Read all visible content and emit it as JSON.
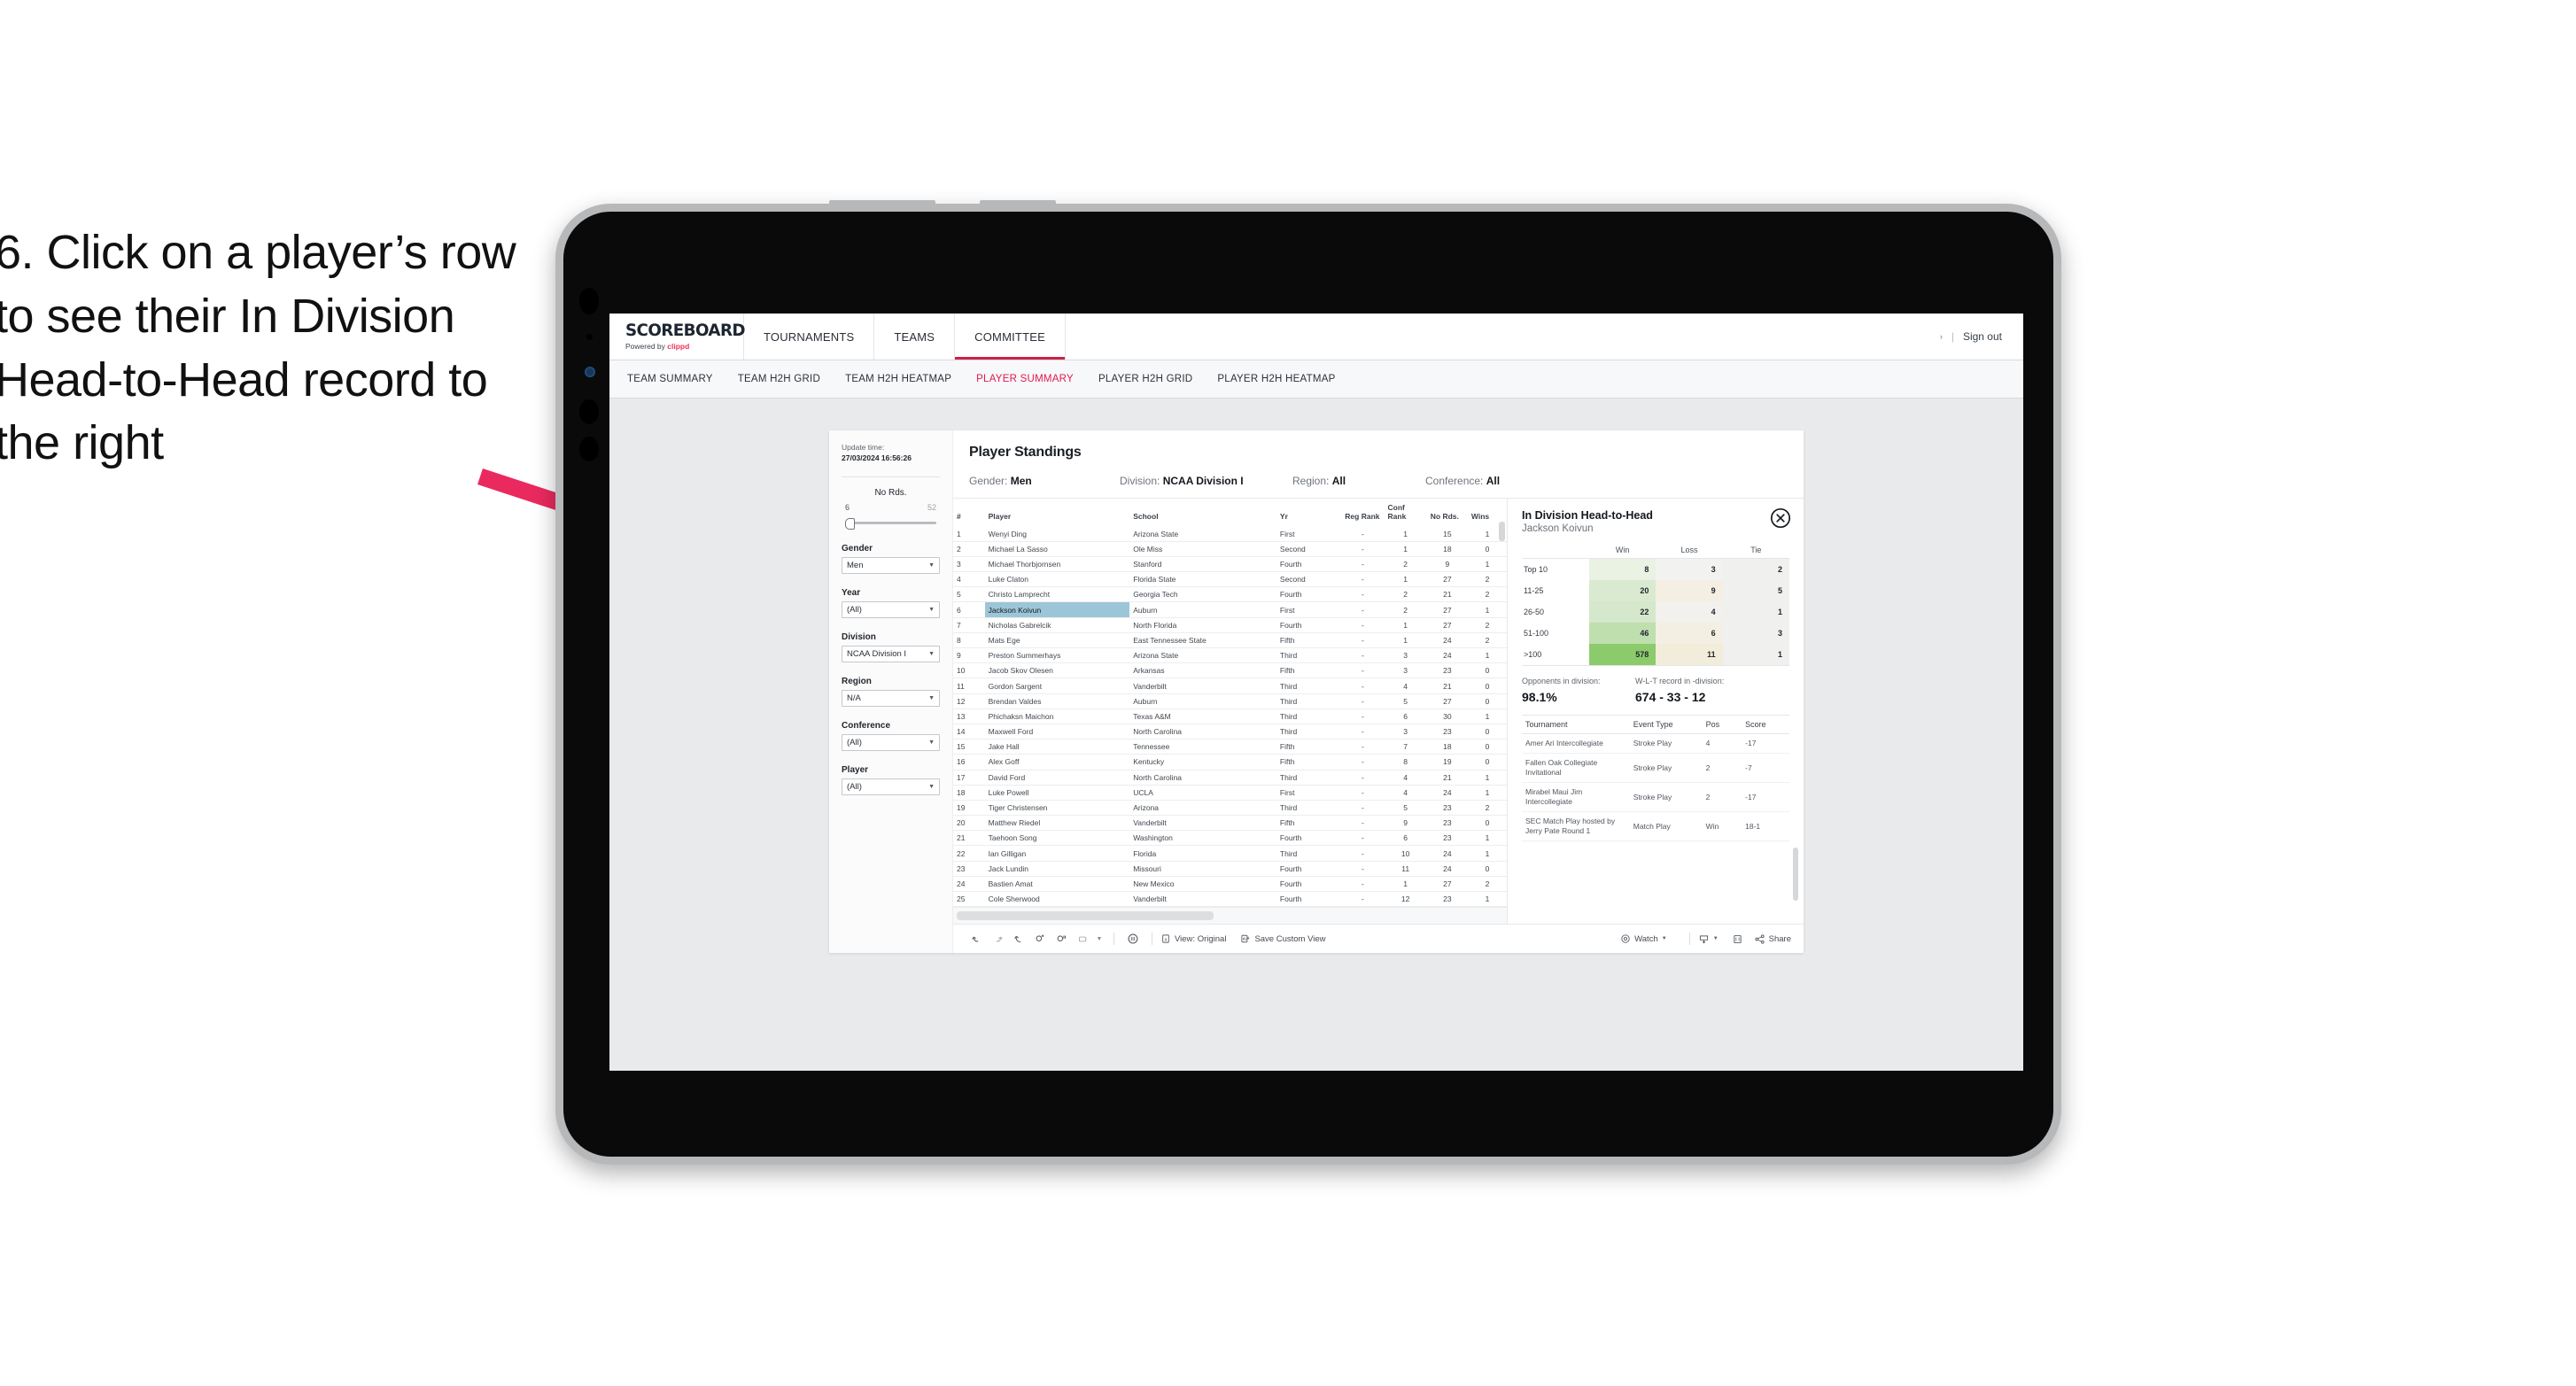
{
  "annotation": {
    "instruction": "6. Click on a player’s row to see their In Division Head-to-Head record to the right",
    "arrow_color": "#ea2a5f"
  },
  "app": {
    "logo_main": "SCOREBOARD",
    "logo_sub_prefix": "Powered by ",
    "logo_brand": "clippd",
    "brand_color": "#f0325a",
    "accent_color": "#e0194f",
    "nav": [
      {
        "label": "TOURNAMENTS",
        "active": false
      },
      {
        "label": "TEAMS",
        "active": false
      },
      {
        "label": "COMMITTEE",
        "active": true
      }
    ],
    "signout": "Sign out",
    "divider": "|",
    "subnav": [
      {
        "label": "TEAM SUMMARY",
        "active": false
      },
      {
        "label": "TEAM H2H GRID",
        "active": false
      },
      {
        "label": "TEAM H2H HEATMAP",
        "active": false
      },
      {
        "label": "PLAYER SUMMARY",
        "active": true
      },
      {
        "label": "PLAYER H2H GRID",
        "active": false
      },
      {
        "label": "PLAYER H2H HEATMAP",
        "active": false
      }
    ]
  },
  "rail": {
    "update_label": "Update time:",
    "update_value": "27/03/2024 16:56:26",
    "slider": {
      "title": "No Rds.",
      "min": "6",
      "max": "52"
    },
    "filters": [
      {
        "label": "Gender",
        "value": "Men"
      },
      {
        "label": "Year",
        "value": "(All)"
      },
      {
        "label": "Division",
        "value": "NCAA Division I"
      },
      {
        "label": "Region",
        "value": "N/A"
      },
      {
        "label": "Conference",
        "value": "(All)"
      },
      {
        "label": "Player",
        "value": "(All)"
      }
    ]
  },
  "standings": {
    "title": "Player Standings",
    "filter_summary": [
      {
        "label": "Gender:",
        "value": "Men"
      },
      {
        "label": "Division:",
        "value": "NCAA Division I"
      },
      {
        "label": "Region:",
        "value": "All"
      },
      {
        "label": "Conference:",
        "value": "All"
      }
    ],
    "columns": [
      "#",
      "Player",
      "School",
      "Yr",
      "Reg Rank",
      "Conf Rank",
      "No Rds.",
      "Wins"
    ],
    "selected_row_index": 5,
    "rows": [
      {
        "num": "1",
        "player": "Wenyi Ding",
        "school": "Arizona State",
        "yr": "First",
        "reg": "-",
        "conf": "1",
        "rds": "15",
        "wins": "1"
      },
      {
        "num": "2",
        "player": "Michael La Sasso",
        "school": "Ole Miss",
        "yr": "Second",
        "reg": "-",
        "conf": "1",
        "rds": "18",
        "wins": "0"
      },
      {
        "num": "3",
        "player": "Michael Thorbjornsen",
        "school": "Stanford",
        "yr": "Fourth",
        "reg": "-",
        "conf": "2",
        "rds": "9",
        "wins": "1"
      },
      {
        "num": "4",
        "player": "Luke Claton",
        "school": "Florida State",
        "yr": "Second",
        "reg": "-",
        "conf": "1",
        "rds": "27",
        "wins": "2"
      },
      {
        "num": "5",
        "player": "Christo Lamprecht",
        "school": "Georgia Tech",
        "yr": "Fourth",
        "reg": "-",
        "conf": "2",
        "rds": "21",
        "wins": "2"
      },
      {
        "num": "6",
        "player": "Jackson Koivun",
        "school": "Auburn",
        "yr": "First",
        "reg": "-",
        "conf": "2",
        "rds": "27",
        "wins": "1"
      },
      {
        "num": "7",
        "player": "Nicholas Gabrelcik",
        "school": "North Florida",
        "yr": "Fourth",
        "reg": "-",
        "conf": "1",
        "rds": "27",
        "wins": "2"
      },
      {
        "num": "8",
        "player": "Mats Ege",
        "school": "East Tennessee State",
        "yr": "Fifth",
        "reg": "-",
        "conf": "1",
        "rds": "24",
        "wins": "2"
      },
      {
        "num": "9",
        "player": "Preston Summerhays",
        "school": "Arizona State",
        "yr": "Third",
        "reg": "-",
        "conf": "3",
        "rds": "24",
        "wins": "1"
      },
      {
        "num": "10",
        "player": "Jacob Skov Olesen",
        "school": "Arkansas",
        "yr": "Fifth",
        "reg": "-",
        "conf": "3",
        "rds": "23",
        "wins": "0"
      },
      {
        "num": "11",
        "player": "Gordon Sargent",
        "school": "Vanderbilt",
        "yr": "Third",
        "reg": "-",
        "conf": "4",
        "rds": "21",
        "wins": "0"
      },
      {
        "num": "12",
        "player": "Brendan Valdes",
        "school": "Auburn",
        "yr": "Third",
        "reg": "-",
        "conf": "5",
        "rds": "27",
        "wins": "0"
      },
      {
        "num": "13",
        "player": "Phichaksn Maichon",
        "school": "Texas A&M",
        "yr": "Third",
        "reg": "-",
        "conf": "6",
        "rds": "30",
        "wins": "1"
      },
      {
        "num": "14",
        "player": "Maxwell Ford",
        "school": "North Carolina",
        "yr": "Third",
        "reg": "-",
        "conf": "3",
        "rds": "23",
        "wins": "0"
      },
      {
        "num": "15",
        "player": "Jake Hall",
        "school": "Tennessee",
        "yr": "Fifth",
        "reg": "-",
        "conf": "7",
        "rds": "18",
        "wins": "0"
      },
      {
        "num": "16",
        "player": "Alex Goff",
        "school": "Kentucky",
        "yr": "Fifth",
        "reg": "-",
        "conf": "8",
        "rds": "19",
        "wins": "0"
      },
      {
        "num": "17",
        "player": "David Ford",
        "school": "North Carolina",
        "yr": "Third",
        "reg": "-",
        "conf": "4",
        "rds": "21",
        "wins": "1"
      },
      {
        "num": "18",
        "player": "Luke Powell",
        "school": "UCLA",
        "yr": "First",
        "reg": "-",
        "conf": "4",
        "rds": "24",
        "wins": "1"
      },
      {
        "num": "19",
        "player": "Tiger Christensen",
        "school": "Arizona",
        "yr": "Third",
        "reg": "-",
        "conf": "5",
        "rds": "23",
        "wins": "2"
      },
      {
        "num": "20",
        "player": "Matthew Riedel",
        "school": "Vanderbilt",
        "yr": "Fifth",
        "reg": "-",
        "conf": "9",
        "rds": "23",
        "wins": "0"
      },
      {
        "num": "21",
        "player": "Taehoon Song",
        "school": "Washington",
        "yr": "Fourth",
        "reg": "-",
        "conf": "6",
        "rds": "23",
        "wins": "1"
      },
      {
        "num": "22",
        "player": "Ian Gilligan",
        "school": "Florida",
        "yr": "Third",
        "reg": "-",
        "conf": "10",
        "rds": "24",
        "wins": "1"
      },
      {
        "num": "23",
        "player": "Jack Lundin",
        "school": "Missouri",
        "yr": "Fourth",
        "reg": "-",
        "conf": "11",
        "rds": "24",
        "wins": "0"
      },
      {
        "num": "24",
        "player": "Bastien Amat",
        "school": "New Mexico",
        "yr": "Fourth",
        "reg": "-",
        "conf": "1",
        "rds": "27",
        "wins": "2"
      },
      {
        "num": "25",
        "player": "Cole Sherwood",
        "school": "Vanderbilt",
        "yr": "Fourth",
        "reg": "-",
        "conf": "12",
        "rds": "23",
        "wins": "1"
      }
    ]
  },
  "h2h": {
    "title": "In Division Head-to-Head",
    "player": "Jackson Koivun",
    "close_icon": "close-circle-icon",
    "matrix": {
      "columns": [
        "Win",
        "Loss",
        "Tie"
      ],
      "rows": [
        {
          "label": "Top 10",
          "win": "8",
          "loss": "3",
          "tie": "2",
          "win_color": "#e9f2e3",
          "loss_color": "#f2f2f0"
        },
        {
          "label": "11-25",
          "win": "20",
          "loss": "9",
          "tie": "5",
          "win_color": "#d9ead0",
          "loss_color": "#f4efe2"
        },
        {
          "label": "26-50",
          "win": "22",
          "loss": "4",
          "tie": "1",
          "win_color": "#d5e8cb",
          "loss_color": "#f2f1ee"
        },
        {
          "label": "51-100",
          "win": "46",
          "loss": "6",
          "tie": "3",
          "win_color": "#bfdfae",
          "loss_color": "#f4efe3"
        },
        {
          "label": ">100",
          "win": "578",
          "loss": "11",
          "tie": "1",
          "win_color": "#8ccb6b",
          "loss_color": "#f2ecdb"
        }
      ]
    },
    "stats": [
      {
        "label": "Opponents in division:",
        "value": "98.1%"
      },
      {
        "label": "W-L-T record in -division:",
        "value": "674 - 33 - 12"
      }
    ],
    "tournaments": {
      "columns": [
        "Tournament",
        "Event Type",
        "Pos",
        "Score"
      ],
      "rows": [
        {
          "name": "Amer Ari Intercollegiate",
          "type": "Stroke Play",
          "pos": "4",
          "score": "-17"
        },
        {
          "name": "Fallen Oak Collegiate Invitational",
          "type": "Stroke Play",
          "pos": "2",
          "score": "-7"
        },
        {
          "name": "Mirabel Maui Jim Intercollegiate",
          "type": "Stroke Play",
          "pos": "2",
          "score": "-17"
        },
        {
          "name": "SEC Match Play hosted by Jerry Pate Round 1",
          "type": "Match Play",
          "pos": "Win",
          "score": "18-1"
        }
      ]
    }
  },
  "toolbar": {
    "view_label": "View: Original",
    "save_label": "Save Custom View",
    "watch_label": "Watch",
    "share_label": "Share"
  }
}
